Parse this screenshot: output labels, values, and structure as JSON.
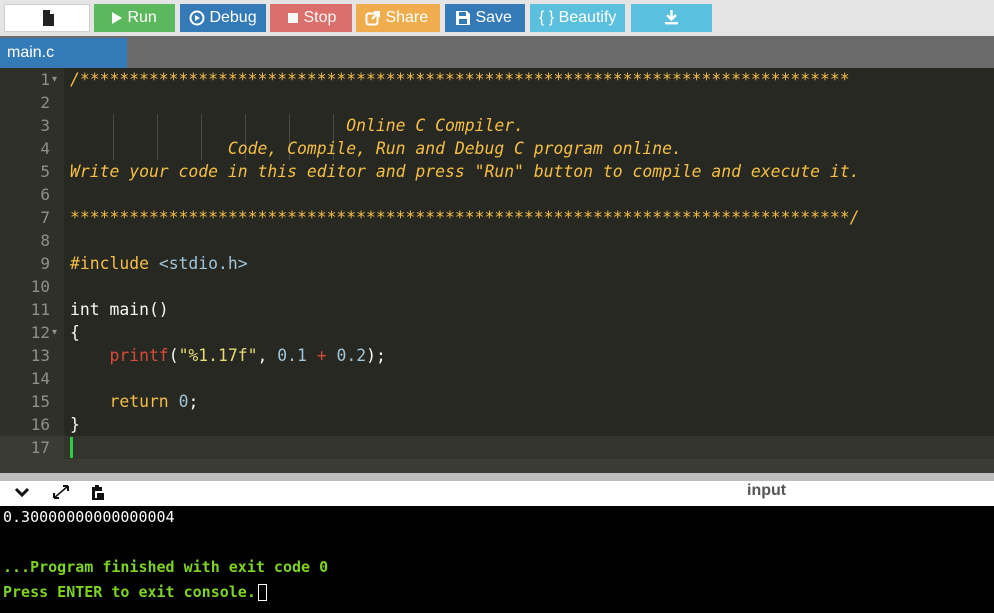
{
  "toolbar": {
    "run_label": "Run",
    "debug_label": "Debug",
    "stop_label": "Stop",
    "share_label": "Share",
    "save_label": "Save",
    "beautify_label": "{ } Beautify",
    "icons": [
      "new-file-icon",
      "play-icon",
      "debug-circle-icon",
      "stop-square-icon",
      "share-icon",
      "floppy-save-icon",
      "download-icon"
    ],
    "colors": {
      "run": "#5cb85c",
      "debug": "#337ab7",
      "stop": "#d9534f",
      "share": "#f0ad4e",
      "save": "#337ab7",
      "beautify": "#5bc0de",
      "download": "#5bc0de"
    }
  },
  "tabs": [
    {
      "label": "main.c",
      "active": true
    }
  ],
  "editor": {
    "line_numbers": [
      "1",
      "2",
      "3",
      "4",
      "5",
      "6",
      "7",
      "8",
      "9",
      "10",
      "11",
      "12",
      "13",
      "14",
      "15",
      "16",
      "17"
    ],
    "lines": {
      "l1": "/******************************************************************************",
      "l3": "                            Online C Compiler.",
      "l4": "                Code, Compile, Run and Debug C program online.",
      "l5": "Write your code in this editor and press \"Run\" button to compile and execute it.",
      "l7": "*******************************************************************************/",
      "l9_kw": "#include",
      "l9_hdr": " <stdio.h>",
      "l11": "int main()",
      "l12": "{",
      "l13_fn": "    printf",
      "l13_p1": "(",
      "l13_str": "\"%1.17f\"",
      "l13_p2": ", ",
      "l13_n1": "0.1",
      "l13_op": " + ",
      "l13_n2": "0.2",
      "l13_end": ");",
      "l15_kw": "    return",
      "l15_sp": " ",
      "l15_n": "0",
      "l15_end": ";",
      "l16": "}"
    },
    "cursor_line": 17
  },
  "console": {
    "input_label": "input",
    "output_value": "0.30000000000000004",
    "finished": "...Program finished with exit code 0",
    "press_enter": "Press ENTER to exit console."
  }
}
